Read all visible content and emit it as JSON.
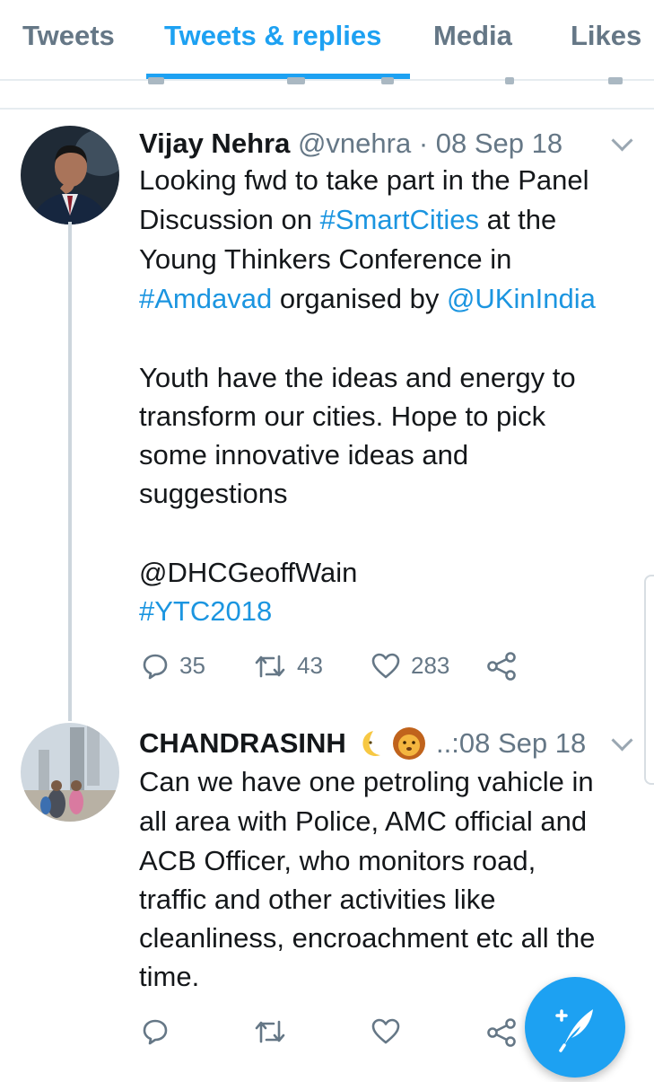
{
  "tabs": [
    {
      "label": "Tweets",
      "active": false
    },
    {
      "label": "Tweets & replies",
      "active": true
    },
    {
      "label": "Media",
      "active": false
    },
    {
      "label": "Likes",
      "active": false
    }
  ],
  "colors": {
    "accent": "#1da1f2",
    "link": "#1b95e0",
    "muted": "#657786",
    "text": "#14171a"
  },
  "tweet1": {
    "author_name": "Vijay Nehra",
    "handle": "@vnehra",
    "separator": "·",
    "date": "08 Sep 18",
    "lines": {
      "l1": "Looking fwd to take part in the Panel",
      "l2_a": "Discussion on ",
      "l2_link": "#SmartCities",
      "l2_b": " at the",
      "l3": "Young Thinkers Conference in",
      "l4_link1": "#Amdavad",
      "l4_a": " organised by ",
      "l4_link2": "@UKinIndia",
      "l5": "Youth have the ideas and energy to",
      "l6": "transform our cities. Hope to pick",
      "l7": "some innovative ideas and",
      "l8": "suggestions",
      "l9": "@DHCGeoffWain",
      "l10_link": "#YTC2018"
    },
    "replies": "35",
    "retweets": "43",
    "likes": "283",
    "icons": [
      "reply-icon",
      "retweet-icon",
      "like-icon",
      "share-icon",
      "chevron-down-icon"
    ]
  },
  "tweet2": {
    "author_name": "CHANDRASINH",
    "emojis": [
      "crescent-moon-emoji",
      "lion-face-emoji"
    ],
    "handle_ellipsis": "..:",
    "date": "08 Sep 18",
    "lines": {
      "l1": "Can we have one petroling vahicle in",
      "l2": "all area with Police, AMC official and",
      "l3": "ACB Officer, who monitors road,",
      "l4": "traffic and other activities like",
      "l5": "cleanliness, encroachment etc all the",
      "l6": "time."
    },
    "icons": [
      "reply-icon",
      "retweet-icon",
      "like-icon",
      "share-icon",
      "chevron-down-icon"
    ]
  },
  "fab": {
    "icon": "compose-tweet-icon",
    "plus": "+"
  }
}
